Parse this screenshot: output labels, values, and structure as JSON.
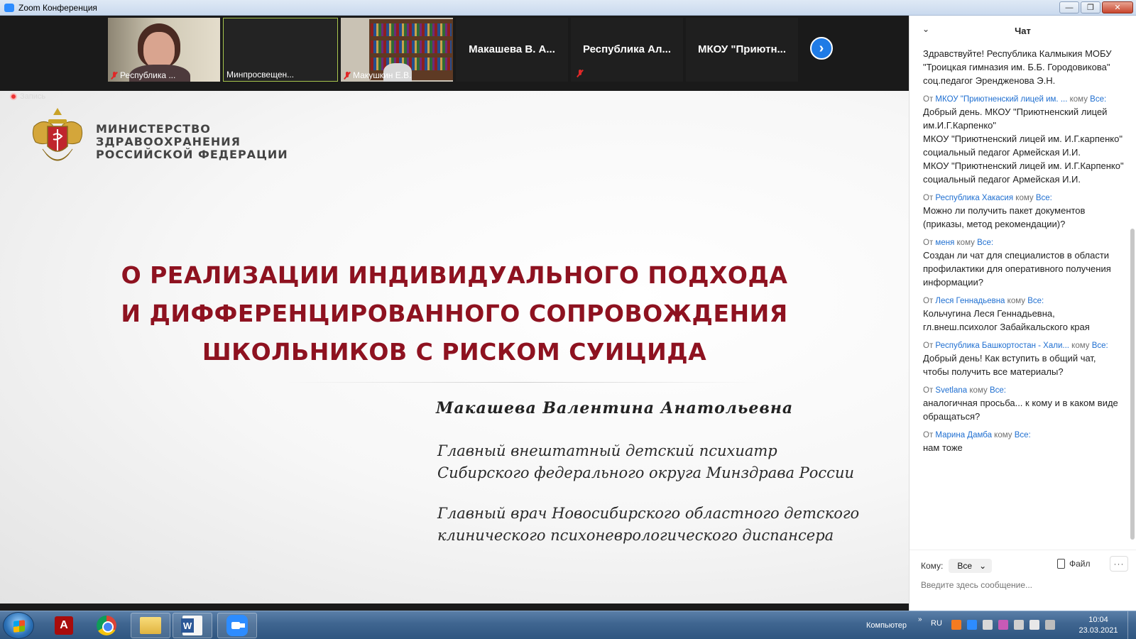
{
  "window": {
    "title": "Zoom Конференция"
  },
  "video_strip": {
    "tiles": [
      {
        "name": "Республика ...",
        "muted": true
      },
      {
        "name": "Минпросвещен...",
        "muted": false,
        "active": true
      },
      {
        "name": "Макушкин Е.В.",
        "muted": true
      }
    ],
    "name_tiles": [
      {
        "name": "Макашева В. А...",
        "muted": false
      },
      {
        "name": "Республика  Ал...",
        "muted": true
      },
      {
        "name": "МКОУ  \"Приютн...",
        "muted": false
      }
    ],
    "next_label": "›"
  },
  "recording": {
    "label": "Запись"
  },
  "slide": {
    "ministry_lines": [
      "МИНИСТЕРСТВО",
      "ЗДРАВООХРАНЕНИЯ",
      "РОССИЙСКОЙ ФЕДЕРАЦИИ"
    ],
    "title_lines": [
      "О РЕАЛИЗАЦИИ ИНДИВИДУАЛЬНОГО  ПОДХОДА",
      "И ДИФФЕРЕНЦИРОВАННОГО  СОПРОВОЖДЕНИЯ",
      "ШКОЛЬНИКОВ С  РИСКОМ СУИЦИДА"
    ],
    "author": "Макашева  Валентина  Анатольевна",
    "role1_lines": [
      "Главный внештатный детский психиатр",
      "Сибирского федерального округа Минздрава России"
    ],
    "role2_lines": [
      "Главный врач Новосибирского областного детского",
      "клинического психоневрологического диспансера"
    ]
  },
  "chat": {
    "title": "Чат",
    "messages": [
      {
        "from": "",
        "to": "",
        "text": "Здравствуйте! Республика Калмыкия МОБУ \"Троицкая гимназия им. Б.Б. Городовикова\" соц.педагог Эрендженова Э.Н."
      },
      {
        "from": "МКОУ \"Приютненский лицей им. ...",
        "to": "Все:",
        "text": "Добрый день. МКОУ \"Приютненский лицей им.И.Г.Карпенко\"\nМКОУ \"Приютненский лицей им. И.Г.карпенко\" социальный педагог Армейская И.И.\nМКОУ \"Приютненский лицей им. И.Г.Карпенко\" социальный педагог Армейская И.И."
      },
      {
        "from": "Республика Хакасия",
        "to": "Все:",
        "text": "Можно ли получить пакет документов (приказы, метод рекомендации)?"
      },
      {
        "from": "меня",
        "to": "Все:",
        "text": "Создан ли чат для специалистов в области профилактики для оперативного получения информации?"
      },
      {
        "from": "Леся Геннадьевна",
        "to": "Все:",
        "text": "Кольчугина Леся Геннадьевна, гл.внеш.психолог Забайкальского края"
      },
      {
        "from": "Республика Башкортостан - Хали...",
        "to": "Все:",
        "text": "Добрый день! Как вступить в общий чат, чтобы получить все материалы?"
      },
      {
        "from": "Svetlana",
        "to": "Все:",
        "text": "аналогичная просьба... к кому и в каком виде обращаться?"
      },
      {
        "from": "Марина Дамба",
        "to": "Все:",
        "text": "нам тоже"
      }
    ],
    "from_prefix": "От",
    "to_word": "кому",
    "recipient_label": "Кому:",
    "recipient_value": "Все",
    "file_label": "Файл",
    "more_label": "···",
    "input_placeholder": "Введите здесь сообщение..."
  },
  "taskbar": {
    "tray_label": "Компьютер",
    "tray_arrow": "»",
    "lang": "RU",
    "time": "10:04",
    "date": "23.03.2021",
    "pdf_glyph": "A"
  }
}
